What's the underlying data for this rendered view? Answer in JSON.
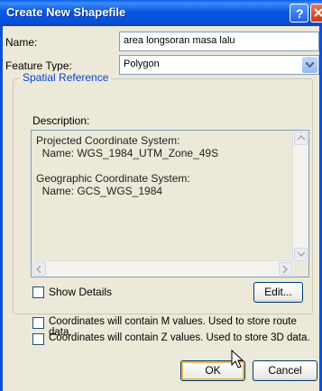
{
  "window": {
    "title": "Create New Shapefile"
  },
  "form": {
    "name_label": "Name:",
    "name_value": "area longsoran masa lalu",
    "feature_type_label": "Feature Type:",
    "feature_type_value": "Polygon"
  },
  "spatial_reference": {
    "group_title": "Spatial Reference",
    "description_label": "Description:",
    "description_text": "Projected Coordinate System:\n  Name: WGS_1984_UTM_Zone_49S\n\nGeographic Coordinate System:\n  Name: GCS_WGS_1984",
    "show_details_label": "Show Details",
    "edit_button": "Edit..."
  },
  "options": {
    "m_values_label": "Coordinates will contain M values. Used to store route data.",
    "z_values_label": "Coordinates will contain Z values. Used to store 3D data."
  },
  "buttons": {
    "ok": "OK",
    "cancel": "Cancel"
  },
  "colors": {
    "title_bar": "#0857e3",
    "group_title": "#0046d5",
    "dialog_bg": "#ece9d8"
  }
}
